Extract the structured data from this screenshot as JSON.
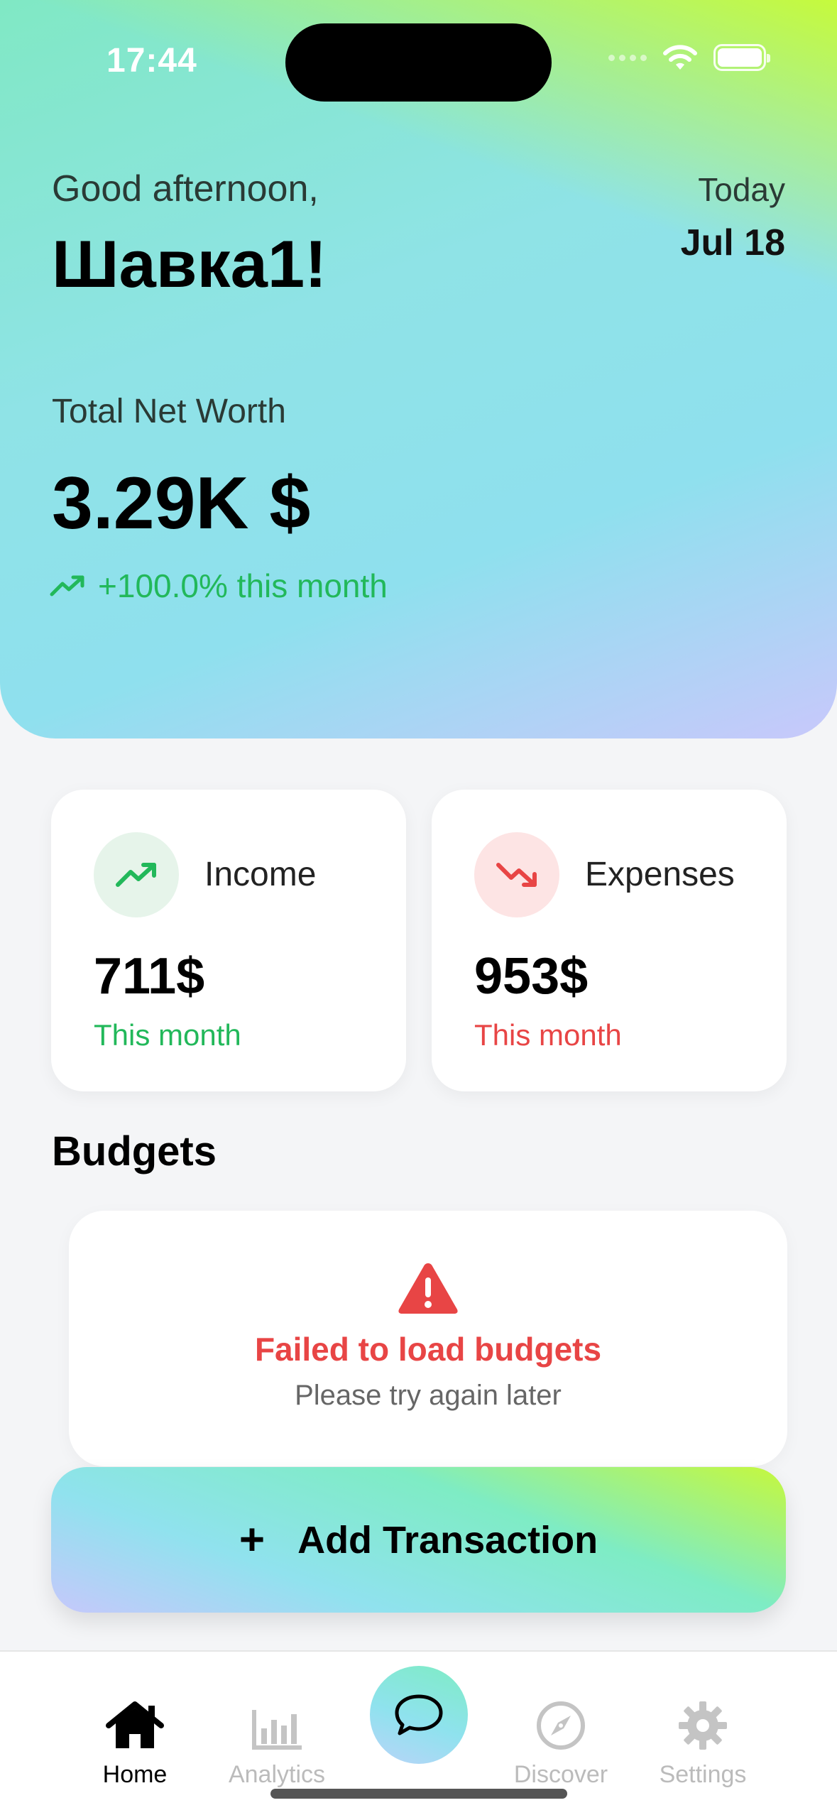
{
  "status_bar": {
    "time": "17:44"
  },
  "header": {
    "greeting": "Good afternoon,",
    "username": "Шавка1!",
    "today_label": "Today",
    "today_date": "Jul 18"
  },
  "net_worth": {
    "label": "Total Net Worth",
    "value": "3.29K $",
    "change": "+100.0% this month",
    "change_color": "#22b85a"
  },
  "summary_cards": {
    "income": {
      "title": "Income",
      "amount": "711$",
      "period": "This month",
      "icon": "trending-up-icon",
      "color": "#22b85a"
    },
    "expenses": {
      "title": "Expenses",
      "amount": "953$",
      "period": "This month",
      "icon": "trending-down-icon",
      "color": "#e84545"
    }
  },
  "budgets": {
    "title": "Budgets",
    "error_title": "Failed to load budgets",
    "error_message": "Please try again later",
    "icon": "warning-icon"
  },
  "actions": {
    "add_transaction": "Add Transaction",
    "add_icon": "plus-icon"
  },
  "tab_bar": {
    "tabs": [
      {
        "label": "Home",
        "icon": "home-icon",
        "active": true
      },
      {
        "label": "Analytics",
        "icon": "bar-chart-icon",
        "active": false
      },
      {
        "label": "",
        "icon": "chat-bubble-icon",
        "active": false
      },
      {
        "label": "Discover",
        "icon": "compass-icon",
        "active": false
      },
      {
        "label": "Settings",
        "icon": "gear-icon",
        "active": false
      }
    ]
  }
}
